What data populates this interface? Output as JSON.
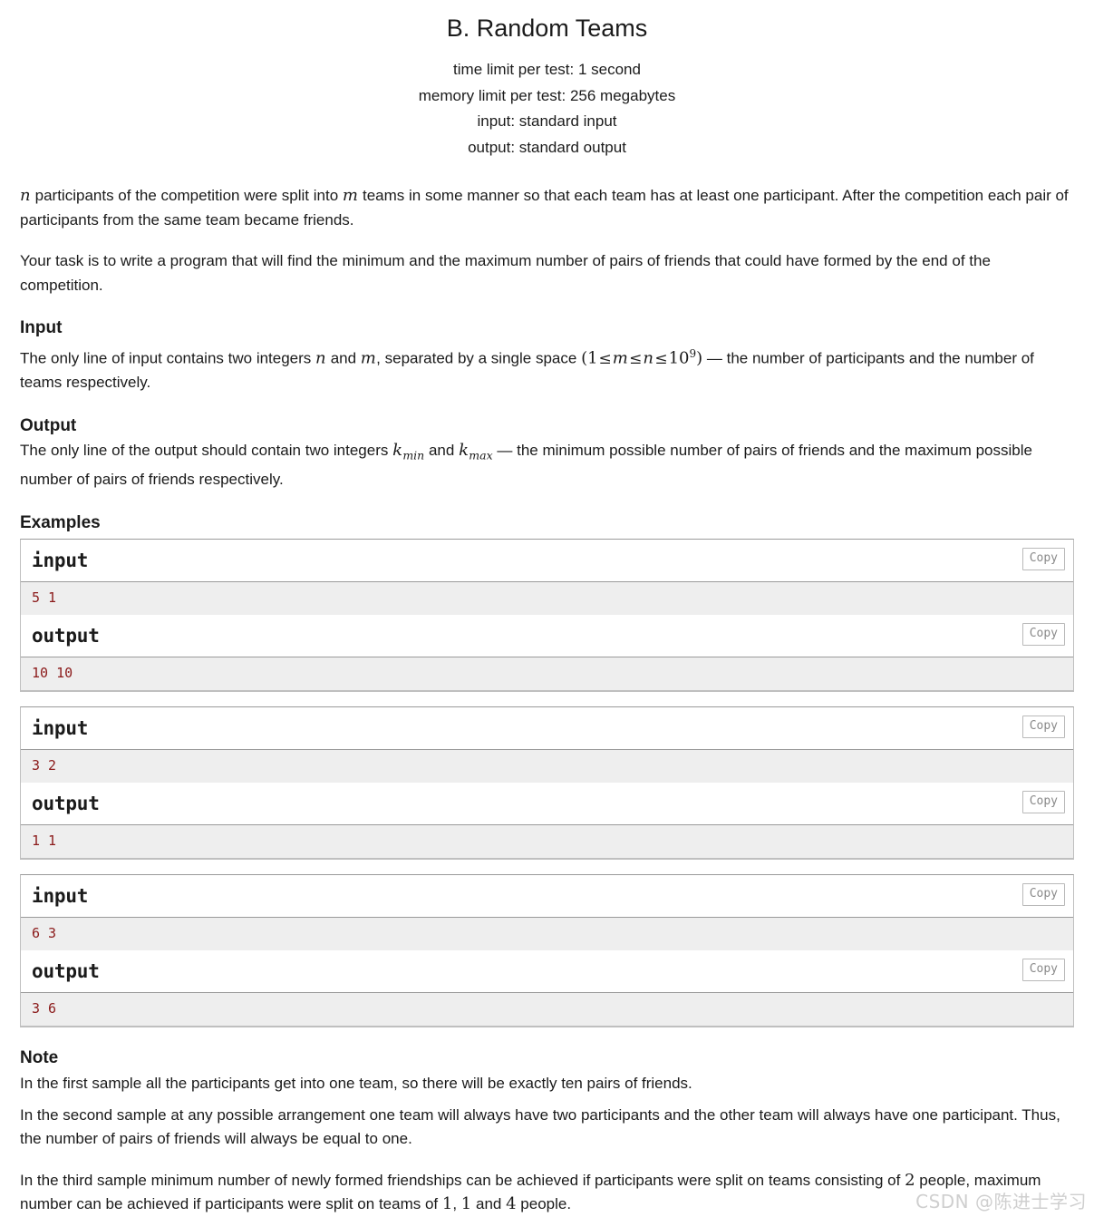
{
  "header": {
    "title": "B. Random Teams",
    "limits": [
      "time limit per test: 1 second",
      "memory limit per test: 256 megabytes",
      "input: standard input",
      "output: standard output"
    ]
  },
  "statement": {
    "p1_a": "participants of the competition were split into",
    "p1_var_n": "n",
    "p1_var_m": "m",
    "p1_b": "teams in some manner so that each team has at least one participant. After the competition each pair of participants from the same team became friends.",
    "p2": "Your task is to write a program that will find the minimum and the maximum number of pairs of friends that could have formed by the end of the competition."
  },
  "input_section": {
    "heading": "Input",
    "text_a": "The only line of input contains two integers",
    "var_n": "n",
    "and": "and",
    "var_m": "m",
    "text_b": ", separated by a single space",
    "math": {
      "open": "(",
      "one": "1",
      "le1": "≤",
      "m": "m",
      "le2": "≤",
      "n": "n",
      "le3": "≤",
      "ten": "10",
      "exp": "9",
      "close": ")"
    },
    "dash": "—",
    "text_c": "the number of participants and the number of teams respectively."
  },
  "output_section": {
    "heading": "Output",
    "text_a": "The only line of the output should contain two integers",
    "k": "k",
    "sub_min": "min",
    "and": "and",
    "sub_max": "max",
    "dash": "—",
    "text_b": "the minimum possible number of pairs of friends and the maximum possible number of pairs of friends respectively."
  },
  "examples": {
    "heading": "Examples",
    "copy_label": "Copy",
    "input_label": "input",
    "output_label": "output",
    "tests": [
      {
        "input": "5 1",
        "output": "10 10"
      },
      {
        "input": "3 2",
        "output": "1 1"
      },
      {
        "input": "6 3",
        "output": "3 6"
      }
    ]
  },
  "note": {
    "heading": "Note",
    "p1": "In the first sample all the participants get into one team, so there will be exactly ten pairs of friends.",
    "p2": "In the second sample at any possible arrangement one team will always have two participants and the other team will always have one participant. Thus, the number of pairs of friends will always be equal to one.",
    "p3_a": "In the third sample minimum number of newly formed friendships can be achieved if participants were split on teams consisting of",
    "p3_num1": "2",
    "p3_b": "people, maximum number can be achieved if participants were split on teams of",
    "p3_num2": "1",
    "p3_comma": ",",
    "p3_num3": "1",
    "p3_c": "and",
    "p3_num4": "4",
    "p3_d": "people."
  },
  "watermark": {
    "text": "CSDN @陈进士学习"
  }
}
